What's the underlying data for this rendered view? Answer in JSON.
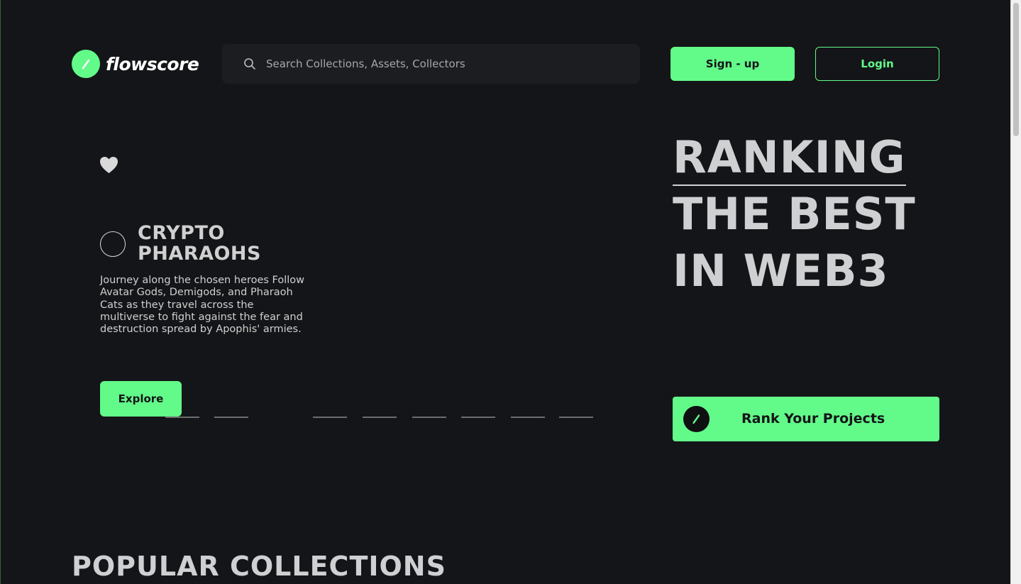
{
  "header": {
    "logo_text": "flowscore",
    "search_placeholder": "Search Collections, Assets, Collectors",
    "signup_label": "Sign - up",
    "login_label": "Login"
  },
  "hero": {
    "featured": {
      "name_line1": "CRYPTO",
      "name_line2": "PHARAOHS",
      "description": "Journey along the chosen heroes Follow Avatar Gods, Demigods, and Pharaoh Cats as they travel across the multiverse to fight against the fear and destruction spread by Apophis' armies.",
      "explore_label": "Explore",
      "slide_count": 9,
      "active_slide": 3
    },
    "title_lines": [
      "RANKING",
      "THE BEST",
      "IN WEB3"
    ],
    "rank_button_label": "Rank Your Projects"
  },
  "sections": {
    "popular_title": "POPULAR COLLECTIONS"
  },
  "colors": {
    "accent": "#62fa89",
    "background": "#141518",
    "text_light": "#cfd0d2"
  },
  "icons": {
    "logo": "flowscore-logo-icon",
    "search": "search-icon",
    "favorite": "heart-icon",
    "rank": "flowscore-logo-icon"
  }
}
